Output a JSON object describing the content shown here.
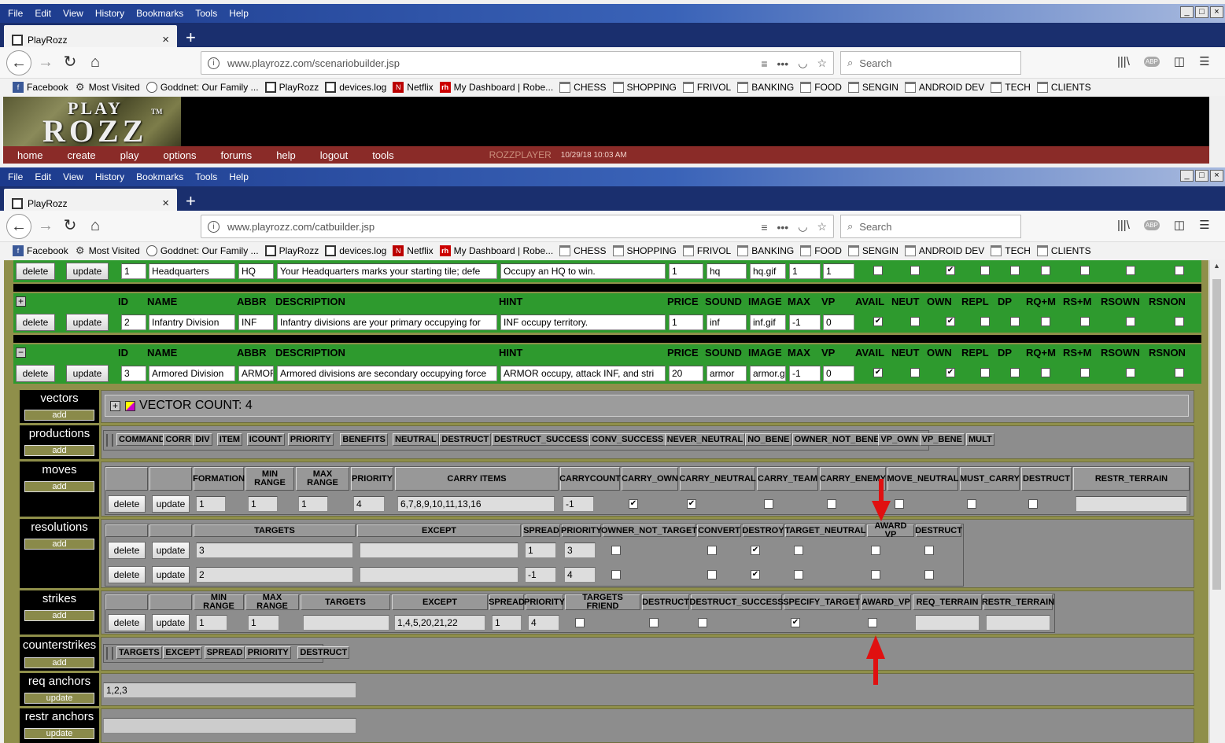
{
  "menu": [
    "File",
    "Edit",
    "View",
    "History",
    "Bookmarks",
    "Tools",
    "Help"
  ],
  "window_controls": [
    "_",
    "□",
    "×"
  ],
  "tab_title": "PlayRozz",
  "tab_close": "×",
  "new_tab": "+",
  "nav_icons": {
    "back": "←",
    "forward": "→",
    "reload": "↻",
    "home": "⌂",
    "info": "i",
    "reader": "≡",
    "more": "•••",
    "pocket": "◡",
    "star": "☆",
    "library": "|||\\",
    "abp": "ABP",
    "sidebar": "◫",
    "hamburger": "☰",
    "search": "⌕"
  },
  "url_top": "www.playrozz.com/scenariobuilder.jsp",
  "url_bottom": "www.playrozz.com/catbuilder.jsp",
  "search_placeholder": "Search",
  "bookmarks": [
    {
      "label": "Facebook",
      "icon": "f"
    },
    {
      "label": "Most Visited",
      "icon": "⚙"
    },
    {
      "label": "Goddnet: Our Family ...",
      "icon": ""
    },
    {
      "label": "PlayRozz",
      "icon": ""
    },
    {
      "label": "devices.log",
      "icon": ""
    },
    {
      "label": "Netflix",
      "icon": "N"
    },
    {
      "label": "My Dashboard | Robe...",
      "icon": "rh"
    },
    {
      "label": "CHESS",
      "icon": ""
    },
    {
      "label": "SHOPPING",
      "icon": ""
    },
    {
      "label": "FRIVOL",
      "icon": ""
    },
    {
      "label": "BANKING",
      "icon": ""
    },
    {
      "label": "FOOD",
      "icon": ""
    },
    {
      "label": "SENGIN",
      "icon": ""
    },
    {
      "label": "ANDROID DEV",
      "icon": ""
    },
    {
      "label": "TECH",
      "icon": ""
    },
    {
      "label": "CLIENTS",
      "icon": ""
    }
  ],
  "logo": {
    "line1": "PLAY",
    "line2": "ROZZ",
    "tm": "TM"
  },
  "sitenav": [
    "home",
    "create",
    "play",
    "options",
    "forums",
    "help",
    "logout",
    "tools"
  ],
  "user": "ROZZPLAYER",
  "timestamp": "10/29/18 10:03 AM",
  "buttons": {
    "delete": "delete",
    "update": "update",
    "add": "add",
    "expand": "+",
    "collapse": "−",
    "scroll_up": "▲"
  },
  "unit_headers": [
    "ID",
    "NAME",
    "ABBR",
    "DESCRIPTION",
    "HINT",
    "PRICE",
    "SOUND",
    "IMAGE",
    "MAX",
    "VP",
    "AVAIL",
    "NEUT",
    "OWN",
    "REPL",
    "DP",
    "RQ+M",
    "RS+M",
    "RSOWN",
    "RSNON"
  ],
  "units": [
    {
      "id": "1",
      "name": "Headquarters",
      "abbr": "HQ",
      "description": "Your Headquarters marks your starting tile; defe",
      "hint": "Occupy an HQ to win.",
      "price": "1",
      "sound": "hq",
      "image": "hq.gif",
      "max": "1",
      "vp": "1",
      "checks": [
        false,
        false,
        true,
        false,
        false,
        false,
        false,
        false,
        false
      ]
    },
    {
      "id": "2",
      "name": "Infantry Division",
      "abbr": "INF",
      "description": "Infantry divisions are your primary occupying for",
      "hint": "INF occupy territory.",
      "price": "1",
      "sound": "inf",
      "image": "inf.gif",
      "max": "-1",
      "vp": "0",
      "checks": [
        true,
        false,
        true,
        false,
        false,
        false,
        false,
        false,
        false
      ]
    },
    {
      "id": "3",
      "name": "Armored Division",
      "abbr": "ARMOR",
      "description": "Armored divisions are secondary occupying force",
      "hint": "ARMOR occupy, attack INF, and stri",
      "price": "20",
      "sound": "armor",
      "image": "armor.gif",
      "max": "-1",
      "vp": "0",
      "checks": [
        true,
        false,
        true,
        false,
        false,
        false,
        false,
        false,
        false
      ]
    }
  ],
  "vectors": {
    "label": "vectors",
    "count_text": "VECTOR COUNT: 4"
  },
  "productions": {
    "label": "productions",
    "columns": [
      "COMMAND",
      "CORR",
      "DIV",
      "ITEM",
      "ICOUNT",
      "PRIORITY",
      "BENEFITS",
      "NEUTRAL",
      "DESTRUCT",
      "DESTRUCT_SUCCESS",
      "CONV_SUCCESS",
      "NEVER_NEUTRAL",
      "NO_BENE",
      "OWNER_NOT_BENE",
      "VP_OWN",
      "VP_BENE",
      "MULT"
    ]
  },
  "moves": {
    "label": "moves",
    "columns": [
      "FORMATION",
      "MIN RANGE",
      "MAX RANGE",
      "PRIORITY",
      "CARRY ITEMS",
      "CARRYCOUNT",
      "CARRY_OWN",
      "CARRY_NEUTRAL",
      "CARRY_TEAM",
      "CARRY_ENEMY",
      "MOVE_NEUTRAL",
      "MUST_CARRY",
      "DESTRUCT",
      "RESTR_TERRAIN"
    ],
    "row": {
      "formation": "1",
      "min_range": "1",
      "max_range": "1",
      "priority": "4",
      "carry_items": "6,7,8,9,10,11,13,16",
      "carrycount": "-1",
      "checks": [
        true,
        true,
        false,
        false,
        false,
        false,
        false
      ],
      "restr_terrain": ""
    }
  },
  "resolutions": {
    "label": "resolutions",
    "columns": [
      "TARGETS",
      "EXCEPT",
      "SPREAD",
      "PRIORITY",
      "OWNER_NOT_TARGET",
      "CONVERT",
      "DESTROY",
      "TARGET_NEUTRAL",
      "AWARD VP",
      "DESTRUCT"
    ],
    "rows": [
      {
        "targets": "3",
        "except": "",
        "spread": "1",
        "priority": "3",
        "checks": [
          false,
          false,
          true,
          false,
          false,
          false
        ]
      },
      {
        "targets": "2",
        "except": "",
        "spread": "-1",
        "priority": "4",
        "checks": [
          false,
          false,
          true,
          false,
          false,
          false
        ]
      }
    ]
  },
  "strikes": {
    "label": "strikes",
    "columns": [
      "MIN RANGE",
      "MAX RANGE",
      "TARGETS",
      "EXCEPT",
      "SPREAD",
      "PRIORITY",
      "TARGETS FRIEND",
      "DESTRUCT",
      "DESTRUCT_SUCCESS",
      "SPECIFY_TARGET",
      "AWARD_VP",
      "REQ_TERRAIN",
      "RESTR_TERRAIN"
    ],
    "row": {
      "min_range": "1",
      "max_range": "1",
      "targets": "",
      "except": "1,4,5,20,21,22",
      "spread": "1",
      "priority": "4",
      "checks": [
        false,
        false,
        false,
        true,
        false
      ],
      "req_terrain": "",
      "restr_terrain": ""
    }
  },
  "counterstrikes": {
    "label": "counterstrikes",
    "columns": [
      "TARGETS",
      "EXCEPT",
      "SPREAD",
      "PRIORITY",
      "DESTRUCT"
    ]
  },
  "req_anchors": {
    "label": "req anchors",
    "value": "1,2,3"
  },
  "restr_anchors": {
    "label": "restr anchors",
    "value": ""
  }
}
